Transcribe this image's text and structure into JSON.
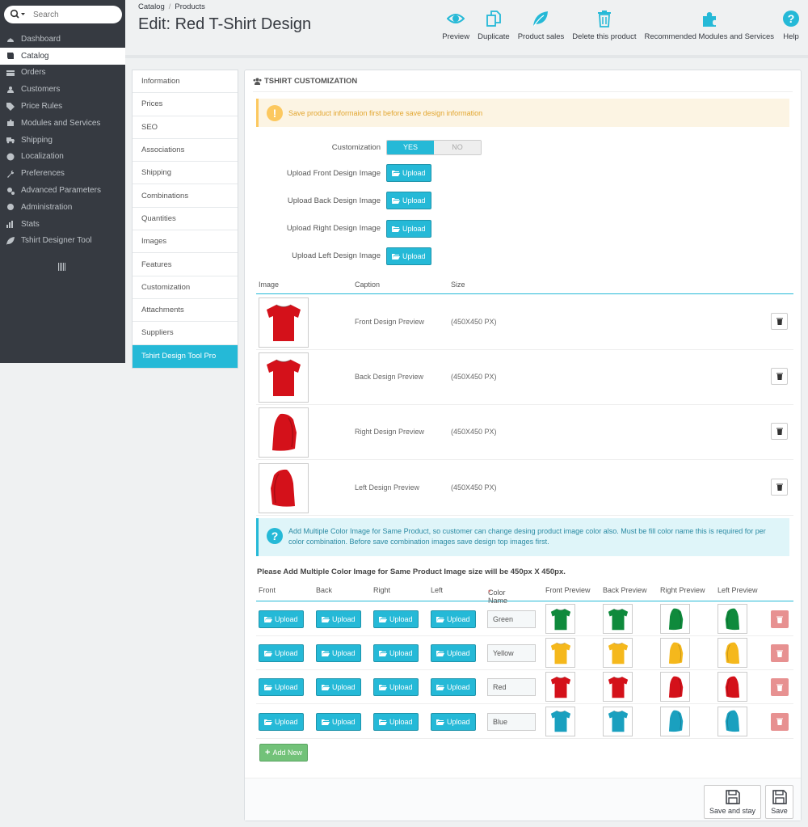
{
  "search": {
    "placeholder": "Search"
  },
  "sidebar": {
    "items": [
      {
        "label": "Dashboard",
        "icon": "dashboard-icon"
      },
      {
        "label": "Catalog",
        "icon": "book-icon"
      },
      {
        "label": "Orders",
        "icon": "credit-card-icon"
      },
      {
        "label": "Customers",
        "icon": "users-icon"
      },
      {
        "label": "Price Rules",
        "icon": "tag-icon"
      },
      {
        "label": "Modules and Services",
        "icon": "puzzle-icon"
      },
      {
        "label": "Shipping",
        "icon": "truck-icon"
      },
      {
        "label": "Localization",
        "icon": "globe-icon"
      },
      {
        "label": "Preferences",
        "icon": "wrench-icon"
      },
      {
        "label": "Advanced Parameters",
        "icon": "cogs-icon"
      },
      {
        "label": "Administration",
        "icon": "gear-icon"
      },
      {
        "label": "Stats",
        "icon": "bar-chart-icon"
      },
      {
        "label": "Tshirt Designer Tool",
        "icon": "leaf-icon"
      }
    ],
    "active": "Catalog"
  },
  "header": {
    "breadcrumb": [
      "Catalog",
      "Products"
    ],
    "title": "Edit: Red T-Shirt Design",
    "toolbar": [
      {
        "label": "Preview",
        "icon": "eye-icon"
      },
      {
        "label": "Duplicate",
        "icon": "copy-icon"
      },
      {
        "label": "Product sales",
        "icon": "leaf-icon"
      },
      {
        "label": "Delete this product",
        "icon": "trash-icon"
      },
      {
        "label": "Recommended Modules and Services",
        "icon": "puzzle-icon"
      },
      {
        "label": "Help",
        "icon": "help-icon"
      }
    ]
  },
  "tabs": [
    "Information",
    "Prices",
    "SEO",
    "Associations",
    "Shipping",
    "Combinations",
    "Quantities",
    "Images",
    "Features",
    "Customization",
    "Attachments",
    "Suppliers",
    "Tshirt Design Tool Pro"
  ],
  "active_tab": "Tshirt Design Tool Pro",
  "panel": {
    "heading": "TSHIRT CUSTOMIZATION",
    "warning": "Save product informaion first before save design information",
    "customization_label": "Customization",
    "yes": "YES",
    "no": "NO",
    "upload_label": "Upload",
    "uploads": [
      "Upload Front Design Image",
      "Upload Back Design Image",
      "Upload Right Design Image",
      "Upload Left Design Image"
    ],
    "image_table": {
      "headers": [
        "Image",
        "Caption",
        "Size"
      ],
      "rows": [
        {
          "caption": "Front Design Preview",
          "size": "(450X450 PX)",
          "view": "front"
        },
        {
          "caption": "Back Design Preview",
          "size": "(450X450 PX)",
          "view": "back"
        },
        {
          "caption": "Right Design Preview",
          "size": "(450X450 PX)",
          "view": "right"
        },
        {
          "caption": "Left Design Preview",
          "size": "(450X450 PX)",
          "view": "left"
        }
      ]
    },
    "info": "Add Multiple Color Image for Same Product, so customer can change desing product image color also. Must be fill color name this is required for per color combination. Before save combination images save design top images first.",
    "multi_title": "Please Add Multiple Color Image for Same Product Image size will be 450px X 450px.",
    "color_table": {
      "headers": [
        "Front",
        "Back",
        "Right",
        "Left",
        "Color Name",
        "Front Preview",
        "Back Preview",
        "Right Preview",
        "Left Preview"
      ],
      "required_mark": "*",
      "rows": [
        {
          "name": "Green",
          "color": "#0f8a3c"
        },
        {
          "name": "Yellow",
          "color": "#f5b81c"
        },
        {
          "name": "Red",
          "color": "#d4111a"
        },
        {
          "name": "Blue",
          "color": "#1aa0bf"
        }
      ]
    },
    "add_new": "Add New",
    "footer": {
      "save_stay": "Save and stay",
      "save": "Save"
    }
  },
  "colors": {
    "accent": "#25b9d7",
    "sidebar": "#363a41",
    "tshirt_red": "#d4111a"
  }
}
